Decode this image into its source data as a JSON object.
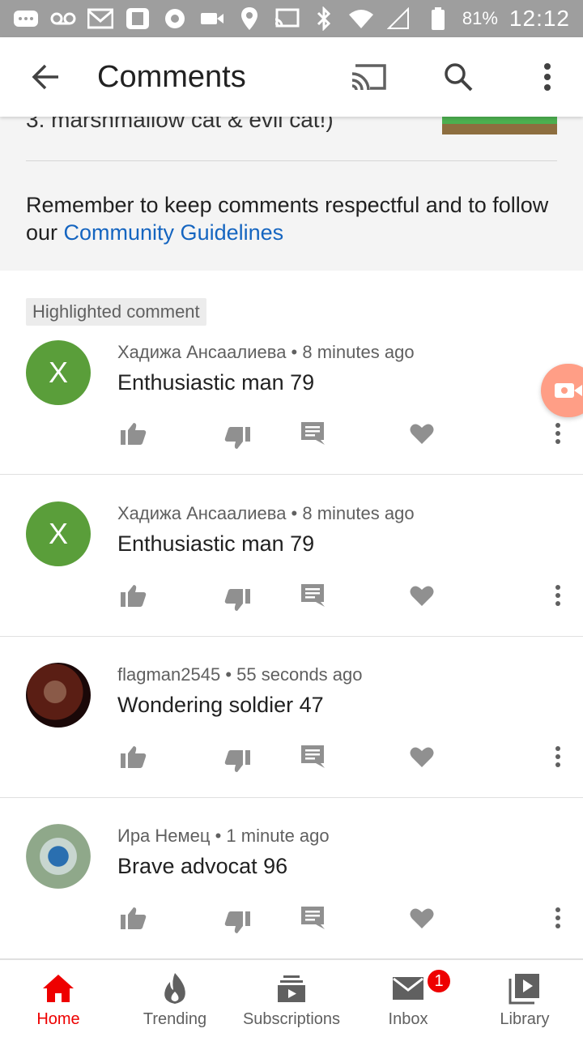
{
  "status_bar": {
    "battery_percent": "81%",
    "time": "12:12"
  },
  "app_bar": {
    "title": "Comments"
  },
  "info": {
    "clipped_title": "3. marshmallow cat & evil cat!)",
    "guidelines_text": "Remember to keep comments respectful and to follow our ",
    "guidelines_link": "Community Guidelines"
  },
  "highlight_badge": "Highlighted comment",
  "comments": [
    {
      "author": "Хадижа Ансаалиева",
      "time": "8 minutes ago",
      "text": "Enthusiastic man 79",
      "avatar_letter": "X",
      "avatar_color": "#5a9e3a"
    },
    {
      "author": "Хадижа Ансаалиева",
      "time": "8 minutes ago",
      "text": "Enthusiastic man 79",
      "avatar_letter": "X",
      "avatar_color": "#5a9e3a"
    },
    {
      "author": "flagman2545",
      "time": "55 seconds ago",
      "text": "Wondering soldier 47",
      "avatar_letter": "",
      "avatar_color": "#3a1410"
    },
    {
      "author": "Ира Немец",
      "time": "1 minute ago",
      "text": "Brave advocat 96",
      "avatar_letter": "",
      "avatar_color": "#8fb0b0"
    }
  ],
  "bottom_nav": {
    "home": "Home",
    "trending": "Trending",
    "subscriptions": "Subscriptions",
    "inbox": "Inbox",
    "inbox_badge": "1",
    "library": "Library"
  },
  "colors": {
    "accent_red": "#ee0000",
    "link_blue": "#1565c0",
    "icon_grey": "#909090"
  }
}
